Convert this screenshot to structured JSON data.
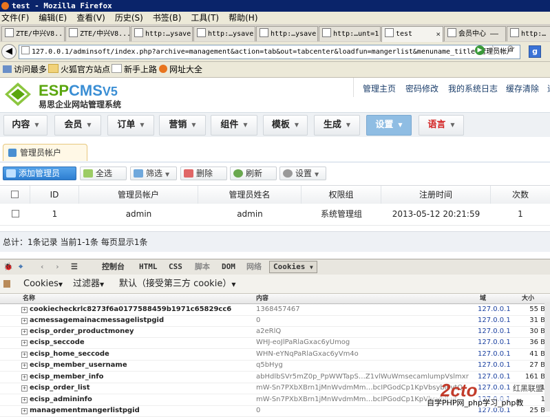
{
  "window": {
    "title": "test - Mozilla Firefox"
  },
  "menu": [
    "文件(F)",
    "编辑(E)",
    "查看(V)",
    "历史(S)",
    "书签(B)",
    "工具(T)",
    "帮助(H)"
  ],
  "tabs": [
    "ZTE/中兴V8...",
    "ZTE/中兴V8...",
    "http:…ysave",
    "http:…ysave",
    "http:…ysave",
    "http:…unt=1",
    "test",
    "会员中心 ——",
    "http:…"
  ],
  "nav": {
    "url": "127.0.0.1/adminsoft/index.php?archive=management&action=tab&out=tabcenter&loadfun=mangerlist&menuname_title=管理员帐户"
  },
  "bookmarks": [
    "访问最多",
    "火狐官方站点",
    "新手上路",
    "网址大全"
  ],
  "app": {
    "logo_main": {
      "esp": "ESP",
      "cms": "CMS",
      "ver": "V5"
    },
    "logo_sub": "易思企业网站管理系统",
    "toplinks": [
      "管理主页",
      "密码修改",
      "我的系统日志",
      "缓存清除",
      "退"
    ],
    "mainnav": [
      "内容",
      "会员",
      "订单",
      "营销",
      "组件",
      "模板",
      "生成",
      "设置",
      "语言"
    ],
    "subtab": "管理员帐户",
    "toolbar": {
      "add": "添加管理员",
      "selectall": "全选",
      "filter": "筛选",
      "delete": "删除",
      "refresh": "刷新",
      "settings": "设置"
    },
    "table": {
      "headers": [
        "ID",
        "管理员帐户",
        "管理员姓名",
        "权限组",
        "注册时间",
        "次数"
      ],
      "rows": [
        [
          "1",
          "admin",
          "admin",
          "系统管理组",
          "2013-05-12 20:21:59",
          "1"
        ]
      ]
    },
    "footer": "总计：1条记录 当前1-1条 每页显示1条"
  },
  "firebug": {
    "tabs": [
      "控制台",
      "HTML",
      "CSS",
      "脚本",
      "DOM",
      "网络",
      "Cookies"
    ],
    "sub": {
      "cookies": "Cookies",
      "filter": "过滤器",
      "default": "默认（接受第三方 cookie）"
    },
    "columns": [
      "名称",
      "内容",
      "域",
      "大小"
    ],
    "cookies": [
      [
        "cookiecheckrlc8273f6a0177588459b1971c65829cc6",
        "1368457467",
        "127.0.0.1",
        "55 B"
      ],
      [
        "acmessagemainacmessagelistpgid",
        "0",
        "127.0.0.1",
        "31 B"
      ],
      [
        "ecisp_order_productmoney",
        "a2eRlQ",
        "127.0.0.1",
        "30 B"
      ],
      [
        "ecisp_seccode",
        "WHJ-eoJlPaRlaGxac6yUmog",
        "127.0.0.1",
        "36 B"
      ],
      [
        "ecisp_home_seccode",
        "WHN-eYNqPaRlaGxac6yVm4o",
        "127.0.0.1",
        "41 B"
      ],
      [
        "ecisp_member_username",
        "q5bHyg",
        "127.0.0.1",
        "27 B"
      ],
      [
        "ecisp_member_info",
        "abHdlbSVr5mZ0p_PpWWTapS…Z1vlWuWmsecamlumpVslmxr",
        "127.0.0.1",
        "161 B"
      ],
      [
        "ecisp_order_list",
        "mW-Sn7PXbXBrn1jMnWvdmMm…bcIPGodCp1KpVbsyblJ-vtQ",
        "127.0.0.1",
        "1"
      ],
      [
        "ecisp_admininfo",
        "mW-Sn7PXbXBrn1jMnWvdmMm…bcIPGodCp1KpVbsyblJ-vt",
        "127.0.0.1",
        "1"
      ],
      [
        "managementmangerlistpgid",
        "0",
        "127.0.0.1",
        "25 B"
      ]
    ]
  },
  "watermark": {
    "logo": "2cto",
    "brand": "红黑联盟",
    "text": "自学PHP网_php学习_php教"
  }
}
